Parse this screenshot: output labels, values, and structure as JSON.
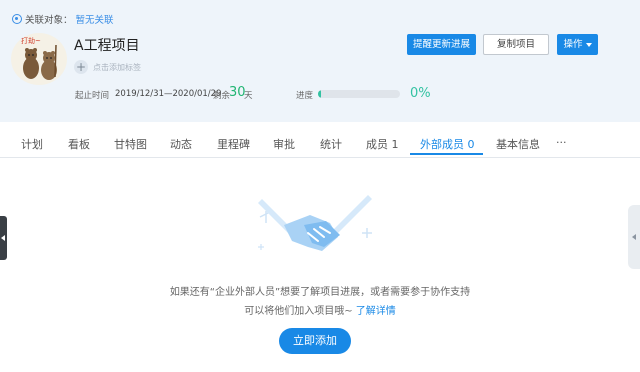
{
  "association": {
    "label": "关联对象：",
    "value": "暂无关联"
  },
  "avatar": {
    "text": "打劫~"
  },
  "project": {
    "title": "A工程项目",
    "add_tag": "点击添加标签",
    "time_label": "起止时间",
    "time_range": "2019/12/31—2020/01/29",
    "remaining_label": "剩余",
    "remaining_days": "30",
    "remaining_unit": "天",
    "progress_label": "进度",
    "progress_text": "0%",
    "progress_value": 0
  },
  "actions": {
    "remind": "提醒更新进展",
    "copy": "复制项目",
    "operate": "操作"
  },
  "tabs": [
    {
      "label": "计划"
    },
    {
      "label": "看板"
    },
    {
      "label": "甘特图"
    },
    {
      "label": "动态"
    },
    {
      "label": "里程碑"
    },
    {
      "label": "审批"
    },
    {
      "label": "统计"
    },
    {
      "label": "成员 1"
    },
    {
      "label": "外部成员 0",
      "active": true
    },
    {
      "label": "基本信息"
    },
    {
      "label": "···"
    }
  ],
  "empty_state": {
    "line1": "如果还有“企业外部人员”想要了解项目进展，或者需要参于协作支持",
    "line2": "可以将他们加入项目哦~",
    "link": "了解详情",
    "button": "立即添加"
  },
  "colors": {
    "primary": "#1989e6",
    "success": "#22b573",
    "progress": "#33c2a2",
    "header_bg": "#eef4fa"
  },
  "icons": [
    "link-icon",
    "plus-icon",
    "chevron-down-icon",
    "handshake-illustration",
    "collapse-left-icon",
    "collapse-right-icon"
  ]
}
